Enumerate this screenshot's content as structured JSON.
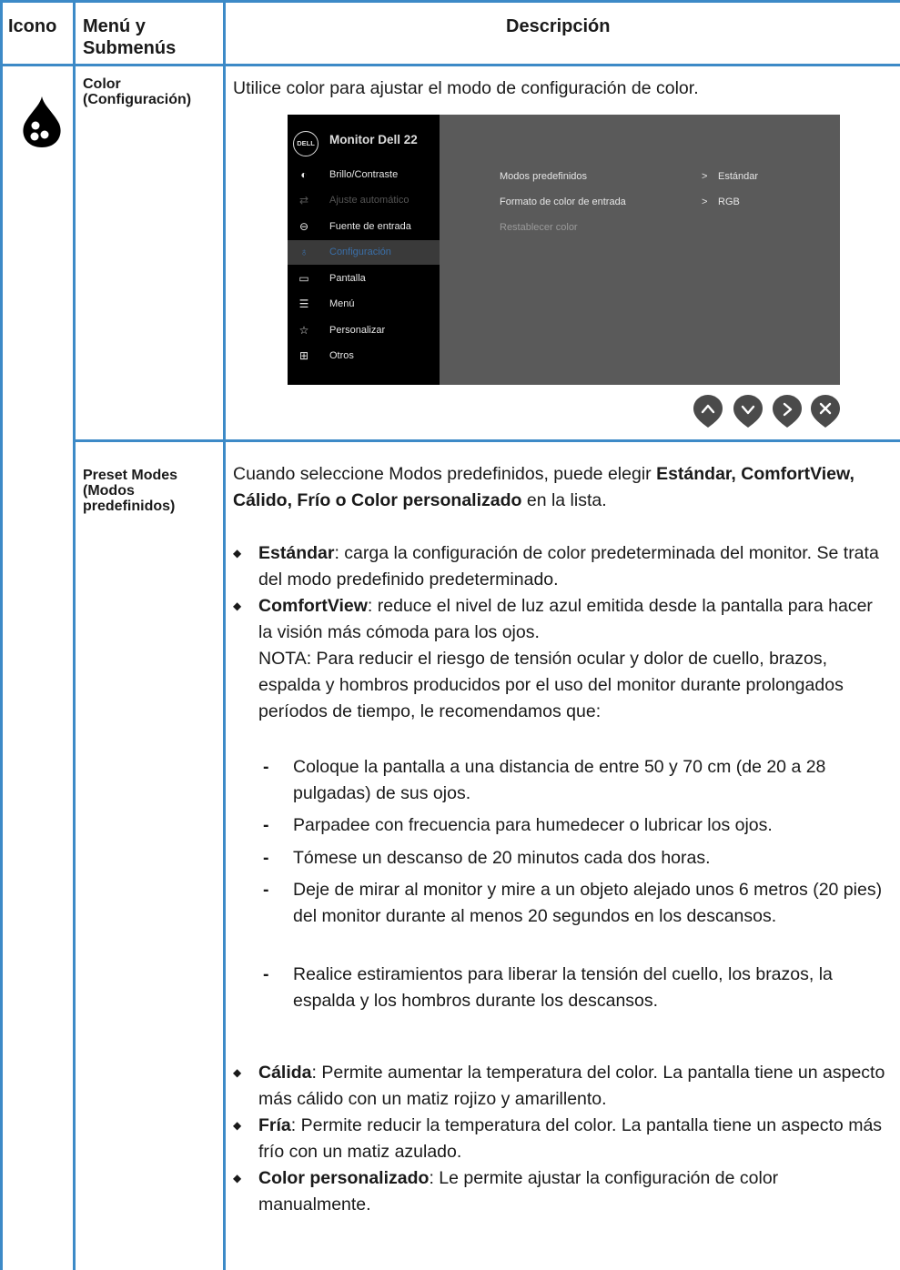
{
  "header": {
    "col_icon": "Icono",
    "col_menu": "Menú y Submenús",
    "col_desc": "Descripción"
  },
  "icons": {
    "color_menu": "color-drop-icon"
  },
  "colors": {
    "grid": "#3d8ac7",
    "osd_panel": "#5a5a5a",
    "osd_menu": "#000000",
    "osd_highlight": "#3a6fa8"
  },
  "row1": {
    "submenu": "Color (Configuración)",
    "intro": "Utilice color para ajustar el modo de configuración de color."
  },
  "osd": {
    "brand": "DELL",
    "title": "Monitor Dell 22",
    "menu": [
      {
        "icon": "brightness-icon",
        "label": "Brillo/Contraste"
      },
      {
        "icon": "auto-adjust-icon",
        "label": "Ajuste automático"
      },
      {
        "icon": "input-source-icon",
        "label": "Fuente de entrada"
      },
      {
        "icon": "color-icon",
        "label": "Configuración"
      },
      {
        "icon": "display-icon",
        "label": "Pantalla"
      },
      {
        "icon": "menu-icon",
        "label": "Menú"
      },
      {
        "icon": "star-icon",
        "label": "Personalizar"
      },
      {
        "icon": "others-icon",
        "label": "Otros"
      }
    ],
    "submenu": [
      {
        "label": "Modos predefinidos",
        "arrow": ">",
        "value": "Estándar"
      },
      {
        "label": "Formato de color de entrada",
        "arrow": ">",
        "value": "RGB"
      },
      {
        "label": "Restablecer color"
      }
    ],
    "buttons": [
      "up-button",
      "down-button",
      "right-button",
      "close-button"
    ]
  },
  "row2": {
    "submenu": "Preset Modes (Modos predefinidos)",
    "intro_a": "Cuando seleccione Modos predefinidos, puede elegir ",
    "intro_bold": "Estándar, ComfortView, Cálido, Frío o Color personalizado",
    "intro_b": " en la lista.",
    "std_term": "Estándar",
    "std_text": ": carga la configuración de color predeterminada del monitor. Se trata del modo predefinido predeterminado.",
    "cv_term": "ComfortView",
    "cv_text": ": reduce el nivel de luz azul emitida desde la pantalla para hacer la visión más cómoda para los ojos.",
    "note": "NOTA: Para reducir el riesgo de tensión ocular y dolor de cuello, brazos, espalda y hombros producidos por el uso del monitor durante prolongados períodos de tiempo, le recomendamos que:",
    "dash": [
      "Coloque la pantalla a una distancia de entre 50 y 70 cm (de 20 a 28 pulgadas) de sus ojos.",
      "Parpadee con frecuencia para humedecer o lubricar los ojos.",
      "Tómese un descanso de 20 minutos cada dos horas.",
      "Deje de mirar al monitor y mire a un objeto alejado unos 6 metros (20 pies) del monitor durante al menos 20 segundos en los descansos.",
      "Realice estiramientos para liberar la tensión del cuello, los brazos, la espalda y los hombros durante los descansos."
    ],
    "warm_term": "Cálida",
    "warm_text": ": Permite aumentar la temperatura del color. La pantalla tiene un aspecto más cálido con un matiz rojizo y amarillento.",
    "cool_term": "Fría",
    "cool_text": ": Permite reducir la temperatura del color. La pantalla tiene un aspecto más frío con un matiz azulado.",
    "custom_term": "Color personalizado",
    "custom_text": ": Le permite ajustar la configuración de color manualmente."
  }
}
